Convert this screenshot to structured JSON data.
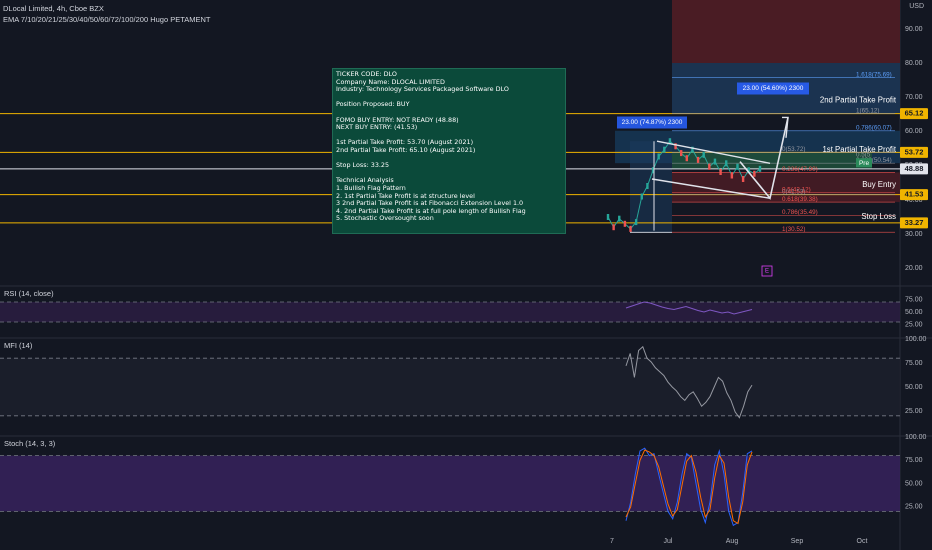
{
  "header": {
    "symbol": "DLocal Limited, 4h, Cboe BZX",
    "indicator": "EMA 7/10/20/21/25/30/40/50/60/72/100/200 Hugo PETAMENT",
    "currency": "USD"
  },
  "note_lines": [
    "TICKER CODE: DLO",
    "Company Name: DLOCAL LIMITED",
    "Industry: Technology Services Packaged Software DLO",
    "",
    "Position Proposed: BUY",
    "",
    "FOMO BUY ENTRY: NOT READY (48.88)",
    "NEXT BUY ENTRY: (41.53)",
    "",
    "1st Partial Take Profit: 53.70 (August 2021)",
    "2nd Partial Take Profit: 65.10 (August 2021)",
    "",
    "Stop Loss: 33.25",
    "",
    "Technical Analysis",
    "1. Bullish Flag Pattern",
    "2. 1st Partial Take Profit is at structure level",
    "3 2nd Partial Take Profit is at Fibonacci Extension Level 1.0",
    "4. 2nd Partial Take Profit is at full pole length of Bullish Flag",
    "5. Stochastic Oversought soon"
  ],
  "chart_data": [
    {
      "type": "line",
      "title": "DLocal Limited, 4h, Cboe BZX",
      "y_ticks": [
        90,
        80,
        70,
        60,
        50,
        40,
        30,
        20
      ],
      "x_ticks": [
        "7",
        "Jul",
        "Aug",
        "Sep",
        "Oct"
      ],
      "price_points": [
        [
          0,
          35.0
        ],
        [
          1,
          32.0
        ],
        [
          2,
          34.5
        ],
        [
          3,
          33.0
        ],
        [
          4,
          31.5
        ],
        [
          5,
          33.5
        ],
        [
          6,
          41.0
        ],
        [
          7,
          44.0
        ],
        [
          8,
          48.5
        ],
        [
          9,
          52.5
        ],
        [
          10,
          54.5
        ],
        [
          11,
          57.0
        ],
        [
          12,
          55.5
        ],
        [
          13,
          53.5
        ],
        [
          14,
          52.0
        ],
        [
          15,
          54.5
        ],
        [
          16,
          51.5
        ],
        [
          17,
          53.0
        ],
        [
          18,
          49.5
        ],
        [
          19,
          51.0
        ],
        [
          20,
          48.0
        ],
        [
          21,
          50.5
        ],
        [
          22,
          47.0
        ],
        [
          23,
          49.5
        ],
        [
          24,
          46.0
        ],
        [
          25,
          48.5
        ],
        [
          26,
          47.5
        ],
        [
          27,
          48.9
        ]
      ],
      "horizontal_levels": [
        {
          "value": 65.12,
          "label": "65.12",
          "color": "#f0b400"
        },
        {
          "value": 53.72,
          "label": "53.72",
          "color": "#f0b400"
        },
        {
          "value": 48.88,
          "label": "48.88",
          "color": "#e0e3eb"
        },
        {
          "value": 41.53,
          "label": "41.53",
          "color": "#f0b400"
        },
        {
          "value": 33.27,
          "label": "33.27",
          "color": "#f0b400"
        }
      ],
      "level_texts": [
        {
          "value": 69.0,
          "label": "2nd Partial Take Profit"
        },
        {
          "value": 54.5,
          "label": "1st Partial Take Profit"
        },
        {
          "value": 44.3,
          "label": "Buy Entry"
        },
        {
          "value": 35.0,
          "label": "Stop Loss"
        },
        {
          "value": 50.5,
          "label": "Pre"
        }
      ],
      "fib_levels": [
        {
          "value": 75.69,
          "label": "1.618(75.69)",
          "color": "#5b9cf6"
        },
        {
          "value": 65.12,
          "label": "1(65.12)",
          "color": "#9598a1"
        },
        {
          "value": 60.07,
          "label": "0.786(60.07)",
          "color": "#5b9cf6"
        },
        {
          "value": 50.54,
          "label": "0.382(50.54)",
          "color": "#9598a1"
        },
        {
          "value": 47.9,
          "label": "0.236(47.90)",
          "color": "#ef5350"
        },
        {
          "value": 41.53,
          "label": "0(41.53)",
          "color": "#9598a1"
        },
        {
          "value": 42.12,
          "label": "0.5(42.12)",
          "color": "#ef5350"
        },
        {
          "value": 39.38,
          "label": "0.618(39.38)",
          "color": "#ef5350"
        },
        {
          "value": 35.49,
          "label": "0.786(35.49)",
          "color": "#ef5350"
        },
        {
          "value": 30.52,
          "label": "1(30.52)",
          "color": "#ef5350"
        },
        {
          "value": 53.72,
          "label": "0(53.72)",
          "color": "#9598a1"
        }
      ],
      "measure_labels": [
        "23.00 (74.87%) 2300",
        "23.00 (54.60%) 2300"
      ],
      "pattern_labels": [
        "0.5(5",
        "0.618"
      ]
    },
    {
      "type": "line",
      "title": "RSI (14, close)",
      "y_ticks": [
        75,
        50,
        25
      ],
      "band": [
        30,
        70
      ],
      "values": [
        58,
        62,
        66,
        70,
        68,
        64,
        60,
        57,
        55,
        58,
        61,
        57,
        53,
        50,
        54,
        51,
        48,
        50,
        46,
        49,
        52,
        55
      ]
    },
    {
      "type": "line",
      "title": "MFI (14)",
      "y_ticks": [
        100,
        75,
        50,
        25
      ],
      "band": [
        20,
        80
      ],
      "values": [
        72,
        85,
        60,
        88,
        92,
        80,
        76,
        70,
        66,
        62,
        55,
        50,
        46,
        40,
        36,
        42,
        45,
        38,
        30,
        34,
        40,
        50,
        60,
        56,
        44,
        36,
        24,
        18,
        30,
        45,
        52
      ]
    },
    {
      "type": "line",
      "title": "Stoch (14, 3, 3)",
      "y_ticks": [
        100,
        75,
        50,
        25
      ],
      "band": [
        20,
        80
      ],
      "series": [
        {
          "name": "%K",
          "values": [
            10,
            30,
            60,
            85,
            88,
            80,
            82,
            60,
            40,
            20,
            12,
            30,
            60,
            82,
            78,
            50,
            22,
            8,
            30,
            70,
            85,
            60,
            20,
            5,
            8,
            40,
            82,
            85
          ]
        },
        {
          "name": "%D",
          "values": [
            14,
            25,
            50,
            75,
            86,
            84,
            80,
            68,
            48,
            28,
            15,
            22,
            48,
            74,
            80,
            62,
            35,
            14,
            22,
            56,
            80,
            72,
            35,
            10,
            7,
            30,
            70,
            84
          ]
        }
      ]
    }
  ]
}
